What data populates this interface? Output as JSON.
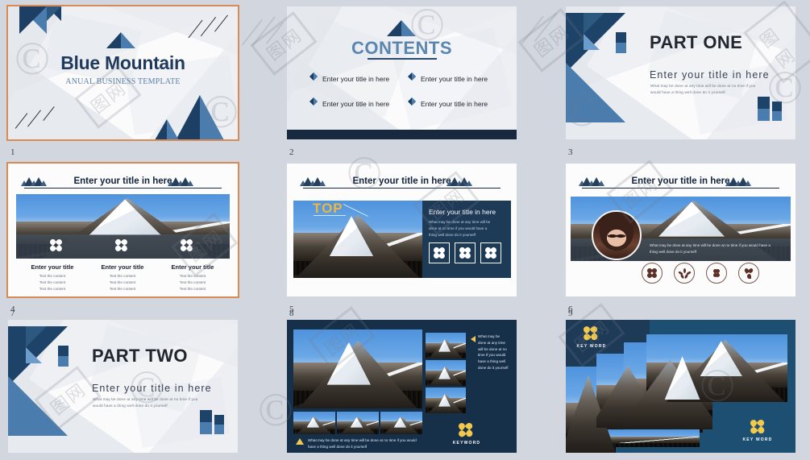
{
  "deck": {
    "background_color": "#d2d6de",
    "selected_slide": 1,
    "selection_color": "#d98b55",
    "accent_navy": "#1d3a57",
    "accent_blue": "#4a7cad",
    "accent_gold": "#f2c94c"
  },
  "common": {
    "title_placeholder": "Enter your title in here",
    "body_text": "What may be done at any time will be done at no time if you would have a thing well done do it yourself",
    "column_title": "Enter your title",
    "column_body_line": "Text the content",
    "keyword_label": "KEY WORD",
    "keyword_label_alt": "KEYWORD"
  },
  "slides": [
    {
      "number": "1",
      "name": "title-slide",
      "selected": true,
      "title": "Blue Mountain",
      "subtitle": "ANUAL BUSINESS TEMPLATE"
    },
    {
      "number": "2",
      "name": "contents-slide",
      "heading": "CONTENTS",
      "items": [
        "Enter your title in here",
        "Enter your title in here",
        "Enter your title in here",
        "Enter your title in here"
      ]
    },
    {
      "number": "3",
      "name": "part-one-divider",
      "heading": "PART ONE",
      "subtitle": "Enter your title in here",
      "body": "What may be done at any time will be done at no time if you would have a thing well done do it yourself"
    },
    {
      "number": "4",
      "name": "three-column-photo-slide",
      "header": "Enter your title in here",
      "columns": [
        {
          "title": "Enter your title",
          "lines": [
            "Text the content",
            "Text the content",
            "Text the content"
          ]
        },
        {
          "title": "Enter your title",
          "lines": [
            "Text the content",
            "Text the content",
            "Text the content"
          ]
        },
        {
          "title": "Enter your title",
          "lines": [
            "Text the content",
            "Text the content",
            "Text the content"
          ]
        }
      ]
    },
    {
      "number": "5",
      "name": "top-callout-slide",
      "header": "Enter your title in here",
      "callout": "TOP",
      "panel_title": "Enter your title in here",
      "panel_body": "What may be done at any time will be done at no time if you would have a thing well done do it yourself",
      "icon_count": 3
    },
    {
      "number": "6",
      "name": "portrait-profile-slide",
      "header": "Enter your title in here",
      "body": "What may be done at any time will be done at no time if you would have a thing well done do it yourself",
      "icon_count": 4
    },
    {
      "number": "7",
      "name": "part-two-divider",
      "heading": "PART TWO",
      "subtitle": "Enter your title in here",
      "body": "What may be done at any time will be done at no time if you would have a thing well done do it yourself"
    },
    {
      "number": "8",
      "name": "photo-gallery-slide",
      "side_body": "What may be done at any time will be done at no time if you would have a thing well done do it yourself",
      "bottom_body": "What may be done at any time will be done at no time if you would have a thing well done do it yourself",
      "keyword": "KEYWORD"
    },
    {
      "number": "9",
      "name": "photo-collage-slide",
      "keyword_top": "KEY WORD",
      "keyword_bottom": "KEY WORD"
    }
  ],
  "watermark": {
    "mark": "图网",
    "glyph": "©"
  }
}
